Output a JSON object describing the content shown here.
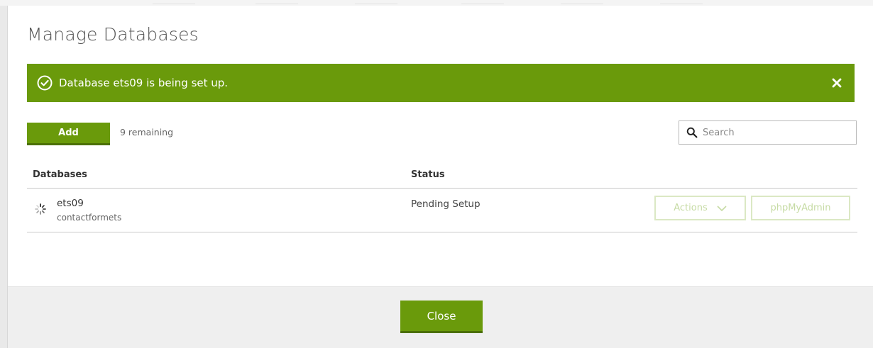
{
  "dialog": {
    "title": "Manage Databases"
  },
  "alert": {
    "message": "Database ets09 is being set up.",
    "icon": "check-circle-icon",
    "close_icon": "close-icon",
    "color": "#6a9a0b"
  },
  "toolbar": {
    "add_label": "Add",
    "remaining_text": "9 remaining",
    "search": {
      "placeholder": "Search",
      "value": "",
      "icon": "search-icon"
    }
  },
  "table": {
    "columns": [
      "Databases",
      "Status"
    ],
    "rows": [
      {
        "name": "ets09",
        "user": "contactformets",
        "status": "Pending Setup",
        "status_icon": "spinner-icon",
        "actions_label": "Actions",
        "actions_icon": "chevron-down-icon",
        "phpmyadmin_label": "phpMyAdmin"
      }
    ]
  },
  "footer": {
    "close_label": "Close"
  },
  "colors": {
    "accent": "#6a9a0b",
    "accent_dark": "#4c7006",
    "disabled_border": "#dbe8c4",
    "disabled_text": "#c6dba4"
  }
}
